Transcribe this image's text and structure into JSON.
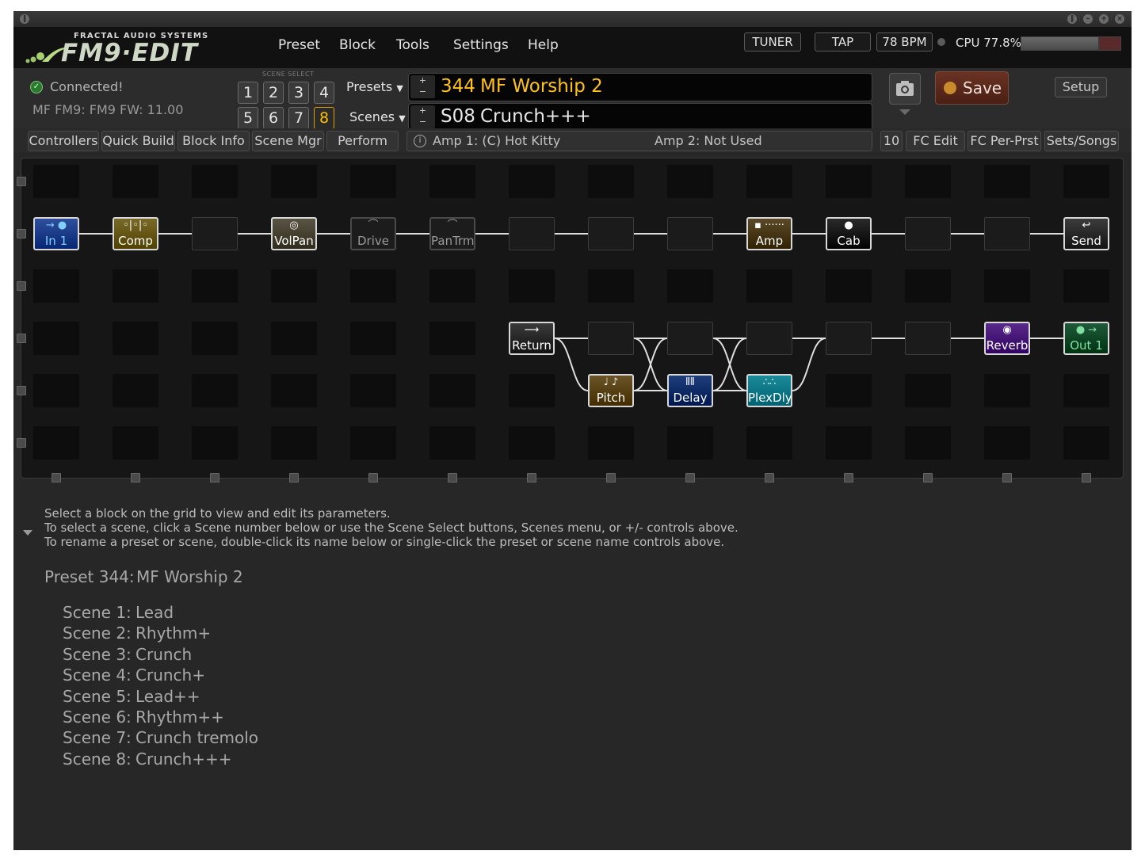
{
  "logo": {
    "company": "FRACTAL AUDIO SYSTEMS",
    "product": "FM9·EDIT"
  },
  "menu": {
    "items": [
      "Preset",
      "Block",
      "Tools",
      "Settings",
      "Help"
    ]
  },
  "header_controls": {
    "tuner": "TUNER",
    "tap": "TAP",
    "bpm": "78 BPM",
    "cpu": "CPU 77.8%",
    "cpu_percent": 77.8
  },
  "status": {
    "connected": "Connected!",
    "firmware": "MF FM9: FM9 FW: 11.00"
  },
  "scene_select": {
    "label": "SCENE SELECT",
    "buttons": [
      "1",
      "2",
      "3",
      "4",
      "5",
      "6",
      "7",
      "8"
    ],
    "active": "8"
  },
  "selectors": {
    "presets_label": "Presets",
    "scenes_label": "Scenes",
    "plus": "+",
    "minus": "−"
  },
  "preset": {
    "number": "344",
    "name": "MF Worship 2"
  },
  "scene": {
    "number": "S08",
    "name": "Crunch+++"
  },
  "actions": {
    "save": "Save",
    "setup": "Setup"
  },
  "toolbar": {
    "left": [
      "Controllers",
      "Quick Build",
      "Block Info",
      "Scene Mgr",
      "Perform"
    ],
    "amp1": "Amp 1: (C) Hot Kitty",
    "amp2": "Amp 2: Not Used",
    "right": [
      "10",
      "FC Edit",
      "FC Per-Prst",
      "Sets/Songs"
    ]
  },
  "grid_blocks": [
    {
      "id": "in1",
      "label": "In 1",
      "row": 1,
      "col": 0,
      "color": "#2f4f9c",
      "text_color": "#7fd0ff",
      "icon": "→ ●",
      "bypassed": false
    },
    {
      "id": "comp",
      "label": "Comp",
      "row": 1,
      "col": 1,
      "color": "#7a6a2a",
      "text_color": "#ffffff",
      "icon": "◦|◦|◦",
      "bypassed": false
    },
    {
      "id": "volpan",
      "label": "VolPan",
      "row": 1,
      "col": 3,
      "color": "#5a5444",
      "text_color": "#ffffff",
      "icon": "◎",
      "bypassed": false
    },
    {
      "id": "drive",
      "label": "Drive",
      "row": 1,
      "col": 4,
      "color": "#1c1c1c",
      "text_color": "#9a9a9a",
      "icon": "⌒",
      "bypassed": true
    },
    {
      "id": "pantrm",
      "label": "PanTrm",
      "row": 1,
      "col": 5,
      "color": "#1c1c1c",
      "text_color": "#9a9a9a",
      "icon": "⌒",
      "bypassed": true
    },
    {
      "id": "amp",
      "label": "Amp",
      "row": 1,
      "col": 9,
      "color": "#5a4a2a",
      "text_color": "#ffffff",
      "icon": "▪ ······",
      "bypassed": false
    },
    {
      "id": "cab",
      "label": "Cab",
      "row": 1,
      "col": 10,
      "color": "#2a2a2a",
      "text_color": "#ffffff",
      "icon": "●",
      "bypassed": false
    },
    {
      "id": "send",
      "label": "Send",
      "row": 1,
      "col": 13,
      "color": "#3c3c3c",
      "text_color": "#ffffff",
      "icon": "↩",
      "bypassed": false
    },
    {
      "id": "return",
      "label": "Return",
      "row": 3,
      "col": 6,
      "color": "#3a3a3a",
      "text_color": "#ffffff",
      "icon": "⟶",
      "bypassed": false
    },
    {
      "id": "reverb",
      "label": "Reverb",
      "row": 3,
      "col": 12,
      "color": "#5a2a8a",
      "text_color": "#ffffff",
      "icon": "◉",
      "bypassed": false
    },
    {
      "id": "out1",
      "label": "Out 1",
      "row": 3,
      "col": 13,
      "color": "#1f5a3a",
      "text_color": "#7fe0a0",
      "icon": "● →",
      "bypassed": false
    },
    {
      "id": "pitch",
      "label": "Pitch",
      "row": 4,
      "col": 7,
      "color": "#6a5428",
      "text_color": "#ffffff",
      "icon": "♩ ♪",
      "bypassed": false
    },
    {
      "id": "delay",
      "label": "Delay",
      "row": 4,
      "col": 8,
      "color": "#1f3f7a",
      "text_color": "#ffffff",
      "icon": "⦀⦀",
      "bypassed": false
    },
    {
      "id": "plexdly",
      "label": "PlexDly",
      "row": 4,
      "col": 9,
      "color": "#1a8a9a",
      "text_color": "#ffffff",
      "icon": "∴∴",
      "bypassed": false
    }
  ],
  "grid_shunts": [
    {
      "row": 1,
      "col": 2
    },
    {
      "row": 1,
      "col": 6
    },
    {
      "row": 1,
      "col": 7
    },
    {
      "row": 1,
      "col": 8
    },
    {
      "row": 1,
      "col": 11
    },
    {
      "row": 1,
      "col": 12
    },
    {
      "row": 3,
      "col": 7
    },
    {
      "row": 3,
      "col": 8
    },
    {
      "row": 3,
      "col": 9
    },
    {
      "row": 3,
      "col": 10
    },
    {
      "row": 3,
      "col": 11
    }
  ],
  "info": {
    "lines": [
      "Select a block on the grid to view and edit its parameters.",
      "To select a scene, click a Scene number below or use the Scene Select buttons, Scenes menu, or +/- controls above.",
      "To rename a preset or scene, double-click its name below or single-click the preset or scene name controls above."
    ],
    "preset_label": "Preset 344:",
    "preset_name": "MF Worship 2",
    "scenes": [
      {
        "label": "Scene 1:",
        "name": "Lead"
      },
      {
        "label": "Scene 2:",
        "name": "Rhythm+"
      },
      {
        "label": "Scene 3:",
        "name": "Crunch"
      },
      {
        "label": "Scene 4:",
        "name": "Crunch+"
      },
      {
        "label": "Scene 5:",
        "name": "Lead++"
      },
      {
        "label": "Scene 6:",
        "name": "Rhythm++"
      },
      {
        "label": "Scene 7:",
        "name": "Crunch tremolo"
      },
      {
        "label": "Scene 8:",
        "name": "Crunch+++"
      }
    ]
  },
  "colors": {
    "preset_text": "#ffc21a",
    "scene_text": "#e8e8e8",
    "accent": "#e0a000"
  }
}
